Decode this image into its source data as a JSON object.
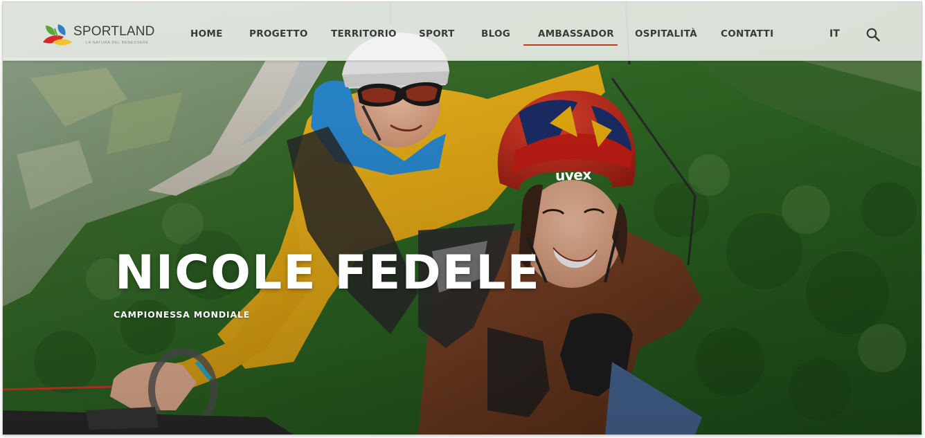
{
  "brand": {
    "name": "SPORTLAND",
    "tagline": "LA NATURA DEL BENESSERE",
    "colors": {
      "leaf_green": "#5aa63a",
      "leaf_yellow": "#f2c12e",
      "leaf_red": "#d8262d",
      "leaf_blue": "#2f7fc1"
    }
  },
  "nav": {
    "items": [
      {
        "label": "HOME"
      },
      {
        "label": "PROGETTO"
      },
      {
        "label": "TERRITORIO"
      },
      {
        "label": "SPORT"
      },
      {
        "label": "BLOG"
      },
      {
        "label": "AMBASSADOR",
        "active": true
      },
      {
        "label": "OSPITALITÀ"
      },
      {
        "label": "CONTATTI"
      }
    ],
    "language": "IT",
    "search_icon": "search-icon",
    "active_color": "#c0392b"
  },
  "hero": {
    "title": "NICOLE FEDELE",
    "subtitle": "CAMPIONESSA MONDIALE",
    "helmet_brand": "uvex"
  }
}
